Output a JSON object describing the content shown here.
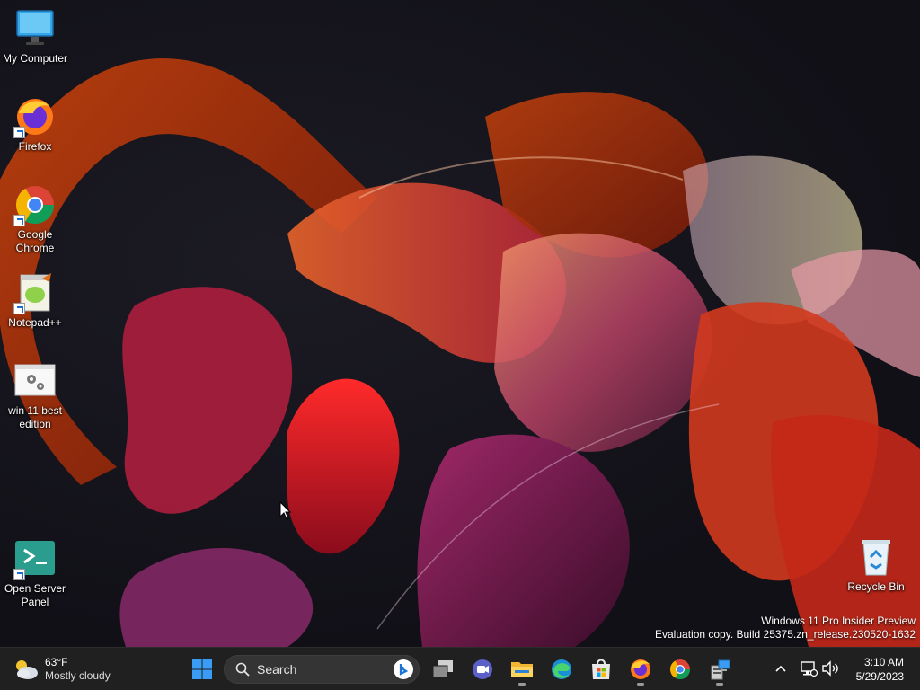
{
  "desktop": {
    "icons": [
      {
        "label": "My Computer",
        "icon": "monitor-icon"
      },
      {
        "label": "Firefox",
        "icon": "firefox-icon"
      },
      {
        "label": "Google Chrome",
        "icon": "chrome-icon"
      },
      {
        "label": "Notepad++",
        "icon": "notepadpp-icon"
      },
      {
        "label": "win 11 best edition",
        "icon": "settings-file-icon"
      },
      {
        "label": "Open Server Panel",
        "icon": "terminal-icon"
      },
      {
        "label": "Recycle Bin",
        "icon": "recycle-bin-icon"
      }
    ],
    "watermark": {
      "line1": "Windows 11 Pro Insider Preview",
      "line2": "Evaluation copy. Build 25375.zn_release.230520-1632"
    }
  },
  "taskbar": {
    "weather": {
      "temp": "63°F",
      "desc": "Mostly cloudy",
      "icon": "cloud-sun-icon"
    },
    "search": {
      "label": "Search"
    },
    "apps": [
      {
        "name": "start",
        "icon": "windows-logo-icon",
        "running": false
      },
      {
        "name": "task-view",
        "icon": "task-view-icon",
        "running": false
      },
      {
        "name": "teams-chat",
        "icon": "chat-icon",
        "running": false
      },
      {
        "name": "file-explorer",
        "icon": "folder-icon",
        "running": true
      },
      {
        "name": "edge",
        "icon": "edge-icon",
        "running": false
      },
      {
        "name": "microsoft-store",
        "icon": "store-icon",
        "running": false
      },
      {
        "name": "firefox",
        "icon": "firefox-icon",
        "running": true
      },
      {
        "name": "chrome",
        "icon": "chrome-icon",
        "running": false
      },
      {
        "name": "server-manager",
        "icon": "server-icon",
        "running": true
      }
    ],
    "clock": {
      "time": "3:10 AM",
      "date": "5/29/2023"
    }
  },
  "colors": {
    "taskbar": "#202020",
    "accent": "#0078d4"
  }
}
